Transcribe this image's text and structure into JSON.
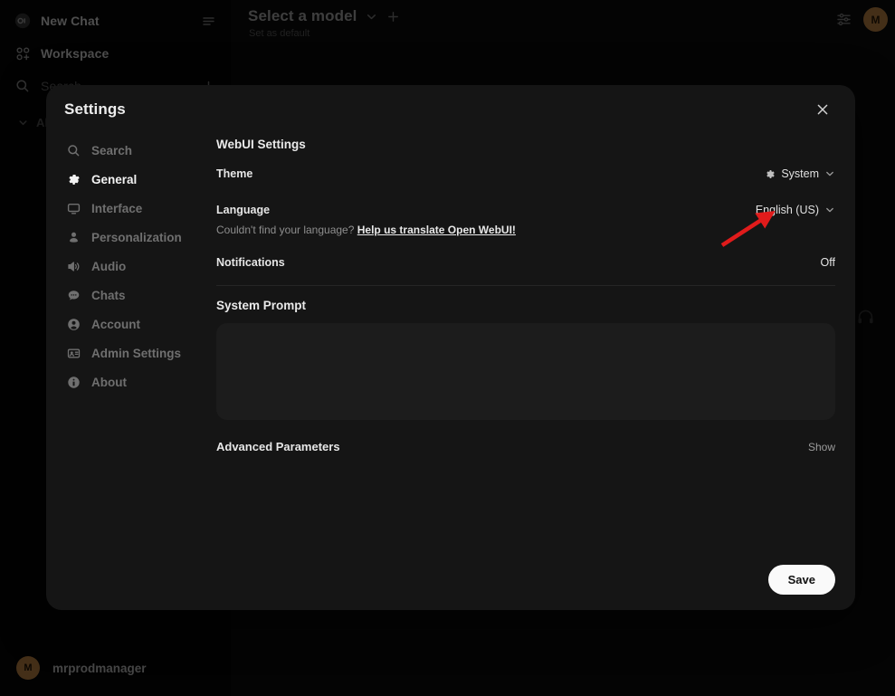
{
  "sidebar": {
    "logo_alt": "open-webui-logo",
    "new_chat": "New Chat",
    "workspace": "Workspace",
    "search_placeholder": "Search",
    "all_chats": "All c",
    "user": {
      "name": "mrprodmanager",
      "initial": "M"
    }
  },
  "topbar": {
    "model_title": "Select a model",
    "set_as_default": "Set as default",
    "avatar_initial": "M"
  },
  "modal": {
    "title": "Settings",
    "nav": [
      {
        "label": "Search",
        "icon": "search-icon",
        "active": false
      },
      {
        "label": "General",
        "icon": "gear-icon",
        "active": true
      },
      {
        "label": "Interface",
        "icon": "monitor-icon",
        "active": false
      },
      {
        "label": "Personalization",
        "icon": "person-icon",
        "active": false
      },
      {
        "label": "Audio",
        "icon": "speaker-icon",
        "active": false
      },
      {
        "label": "Chats",
        "icon": "chat-bubble-icon",
        "active": false
      },
      {
        "label": "Account",
        "icon": "user-circle-icon",
        "active": false
      },
      {
        "label": "Admin Settings",
        "icon": "id-card-icon",
        "active": false
      },
      {
        "label": "About",
        "icon": "info-icon",
        "active": false
      }
    ],
    "webui_settings_title": "WebUI Settings",
    "theme": {
      "label": "Theme",
      "value": "System"
    },
    "language": {
      "label": "Language",
      "value": "English (US)"
    },
    "language_help": {
      "text": "Couldn't find your language?",
      "link": "Help us translate Open WebUI!"
    },
    "notifications": {
      "label": "Notifications",
      "value": "Off"
    },
    "system_prompt": {
      "label": "System Prompt",
      "value": "",
      "placeholder": ""
    },
    "advanced": {
      "label": "Advanced Parameters",
      "toggle": "Show"
    },
    "save_label": "Save"
  },
  "annotation": {
    "arrow_color": "#e01b1b"
  },
  "colors": {
    "app_background": "#0a0a0a",
    "sidebar_background": "#050505",
    "modal_background": "#151515",
    "accent_avatar": "#a3703a",
    "save_button": "#fafafa"
  }
}
